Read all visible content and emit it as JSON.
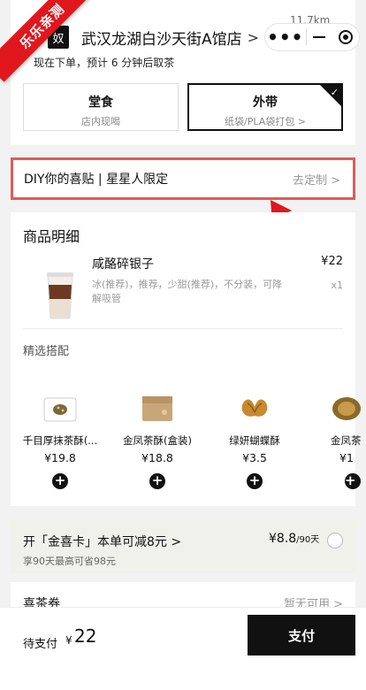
{
  "header": {
    "store_badge": "奴",
    "store_name": "武汉龙湖白沙天街A馆店",
    "store_chevron": ">",
    "distance": "11.7km",
    "pickup_note": "现在下单，预计 6 分钟后取茶",
    "ribbon": "乐乐亲测"
  },
  "order_type": {
    "dine_in": {
      "title": "堂食",
      "sub": "店内现喝"
    },
    "takeaway": {
      "title": "外带",
      "sub": "纸袋/PLA袋打包 >",
      "selected": true
    }
  },
  "diy": {
    "title": "DIY你的喜贴 | 星星人限定",
    "action": "去定制 >"
  },
  "goods": {
    "section_title": "商品明细",
    "item": {
      "name": "咸酪碎银子",
      "price": "¥22",
      "spec": "冰(推荐)，推荐，少甜(推荐)，不分装，可降解吸管",
      "qty": "x1"
    },
    "recommend_title": "精选搭配",
    "recommendations": [
      {
        "name": "千目厚抹茶酥(...",
        "price": "¥19.8",
        "icon": "matcha-pastry-box-icon"
      },
      {
        "name": "金凤茶酥(盒装)",
        "price": "¥18.8",
        "icon": "pastry-box-icon"
      },
      {
        "name": "绿妍蝴蝶酥",
        "price": "¥3.5",
        "icon": "butterfly-pastry-icon"
      },
      {
        "name": "金凤茶",
        "price": "¥1",
        "icon": "pastry-icon"
      }
    ],
    "add_symbol": "+"
  },
  "promo": {
    "title": "开「金喜卡」本单可减8元 >",
    "sub": "享90天最高可省98元",
    "price": "¥8.8",
    "period": "/90天"
  },
  "coupon": {
    "label": "喜茶券",
    "value": "暂无可用 >"
  },
  "footer": {
    "pay_label": "待支付",
    "currency": "¥",
    "amount": "22",
    "pay_button": "支付"
  },
  "colors": {
    "accent": "#111111",
    "highlight_border": "#e05a5a",
    "ribbon": "#e0171d",
    "promo_bg": "#f0f1ea"
  }
}
